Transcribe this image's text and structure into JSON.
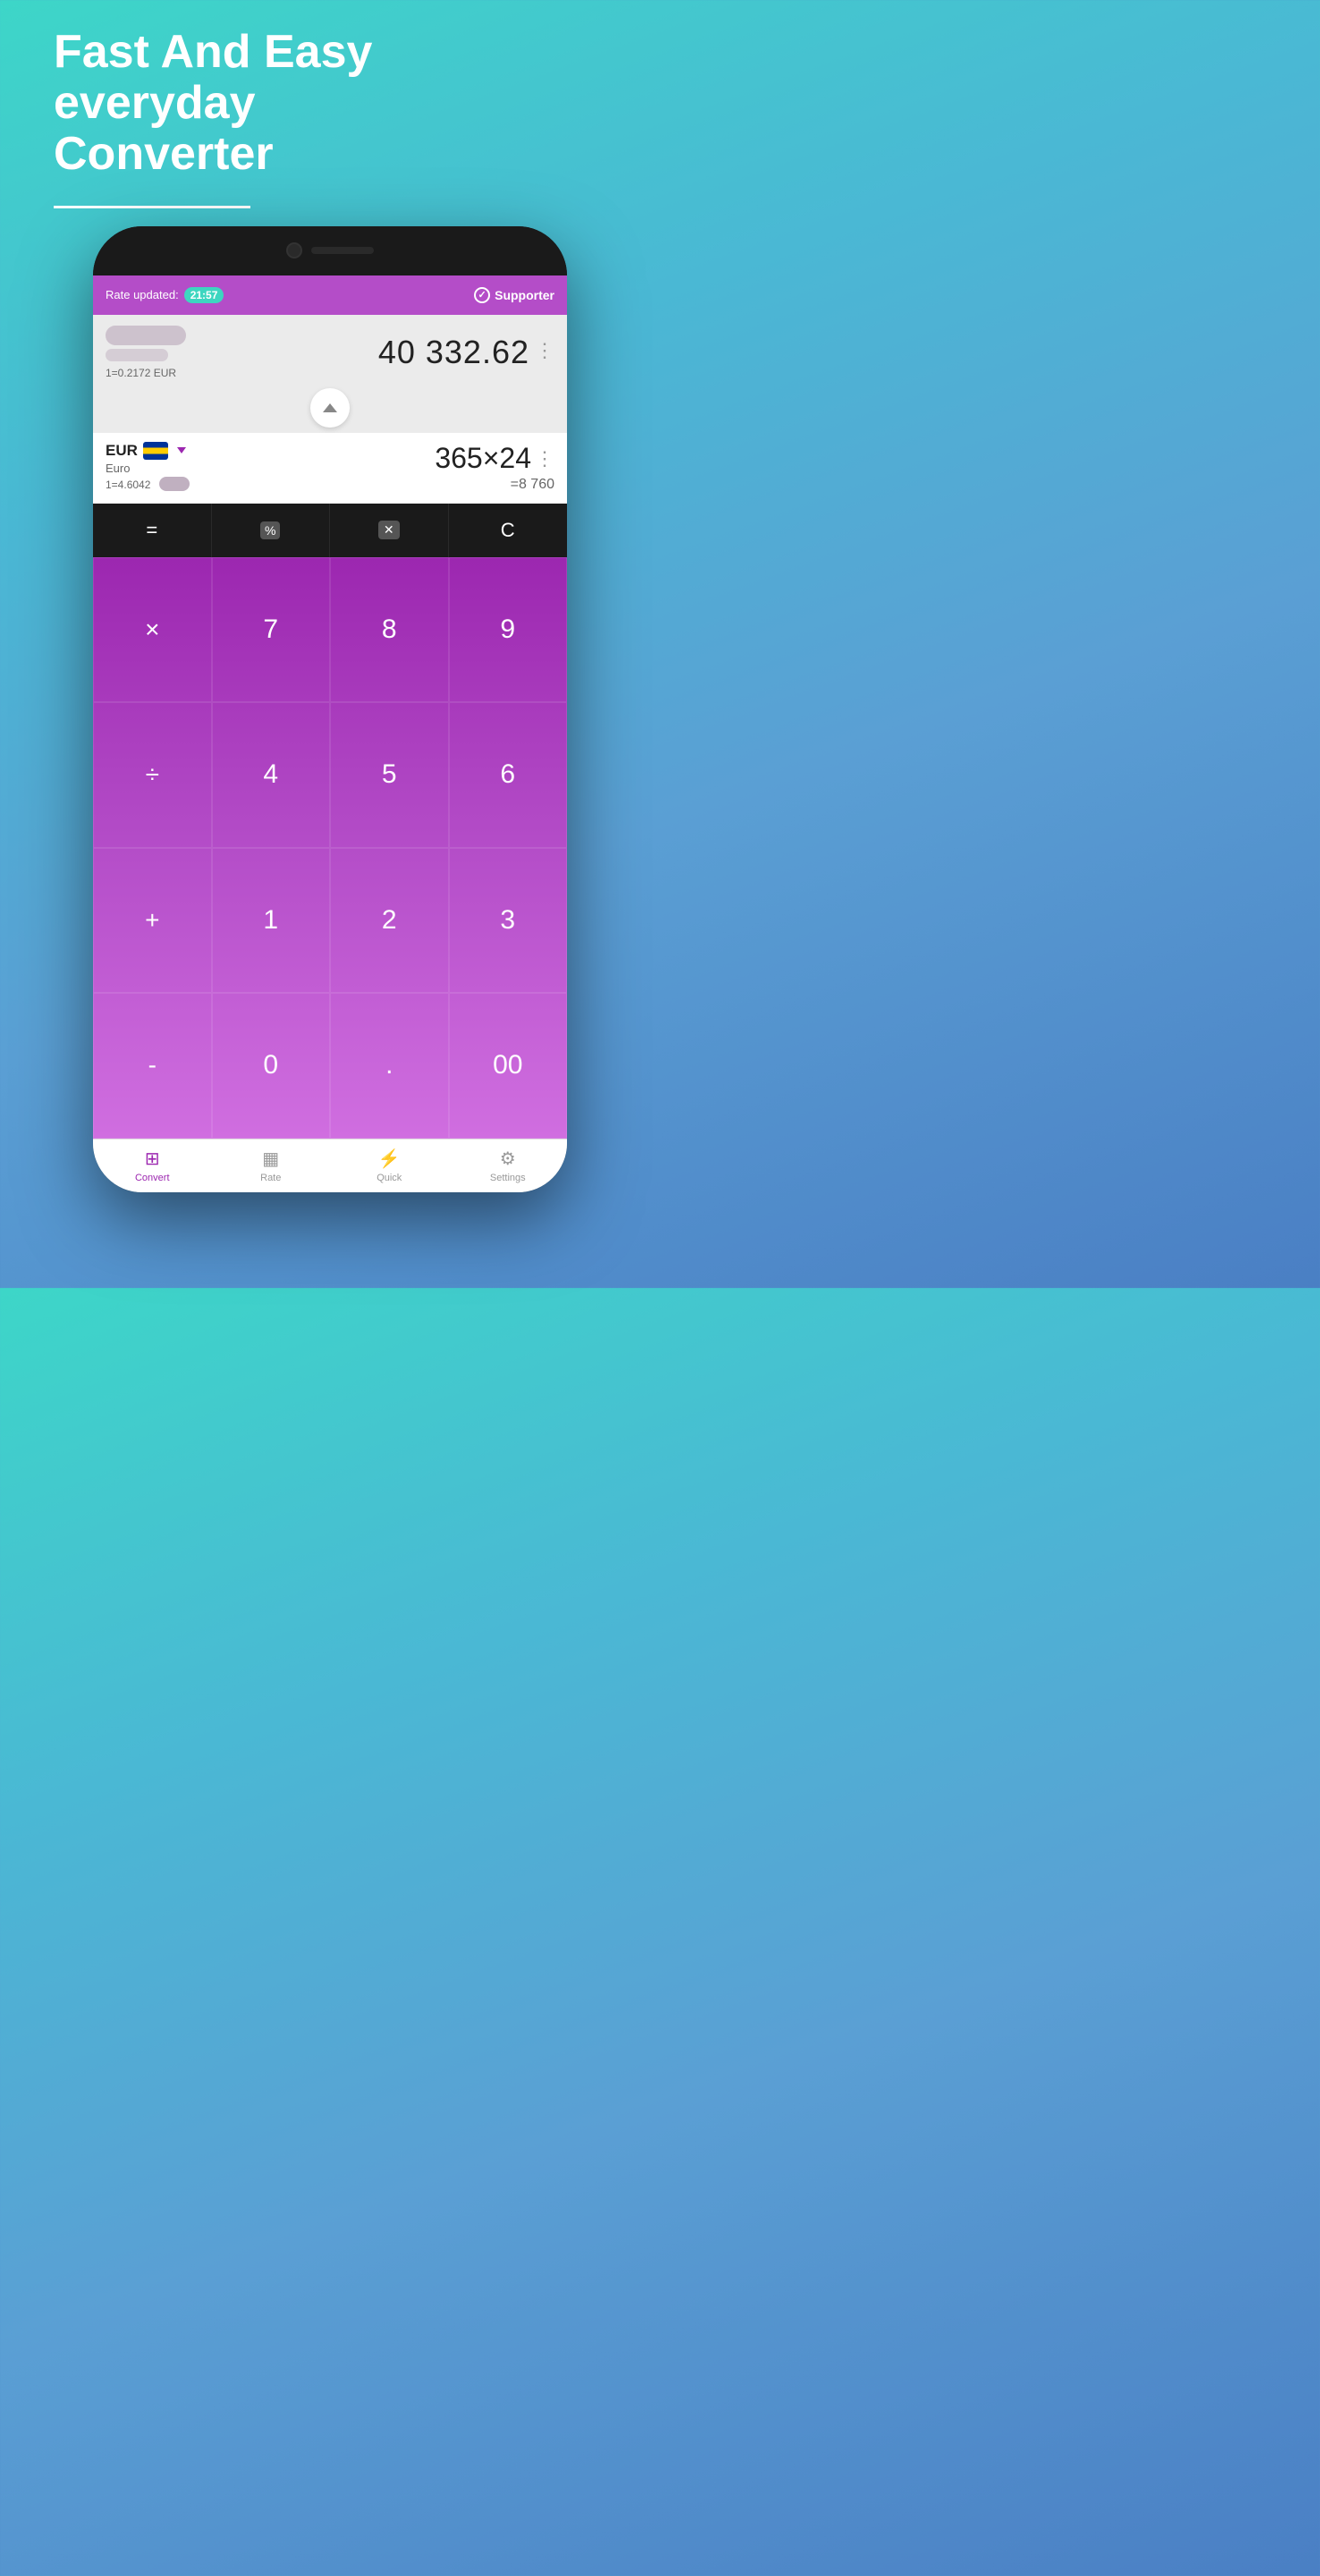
{
  "hero": {
    "line1": "Fast And Easy",
    "line2": "everyday",
    "line3": "Converter"
  },
  "statusBar": {
    "rateLabel": "Rate updated:",
    "time": "21:57",
    "supporter": "Supporter"
  },
  "currencyRow1": {
    "rate": "1=0.2172 EUR",
    "amount": "40 332.62"
  },
  "currencyRow2": {
    "code": "EUR",
    "name": "Euro",
    "rate": "1=4.6042",
    "expr": "365×24",
    "result": "=8 760"
  },
  "keypad": {
    "ops": [
      "=",
      "%",
      "⌫",
      "C"
    ],
    "buttons": [
      "×",
      "7",
      "8",
      "9",
      "÷",
      "4",
      "5",
      "6",
      "+",
      "1",
      "2",
      "3",
      "-",
      "0",
      ".",
      "00"
    ]
  },
  "nav": {
    "items": [
      {
        "label": "Convert",
        "active": true
      },
      {
        "label": "Rate",
        "active": false
      },
      {
        "label": "Quick",
        "active": false
      },
      {
        "label": "Settings",
        "active": false
      }
    ]
  }
}
